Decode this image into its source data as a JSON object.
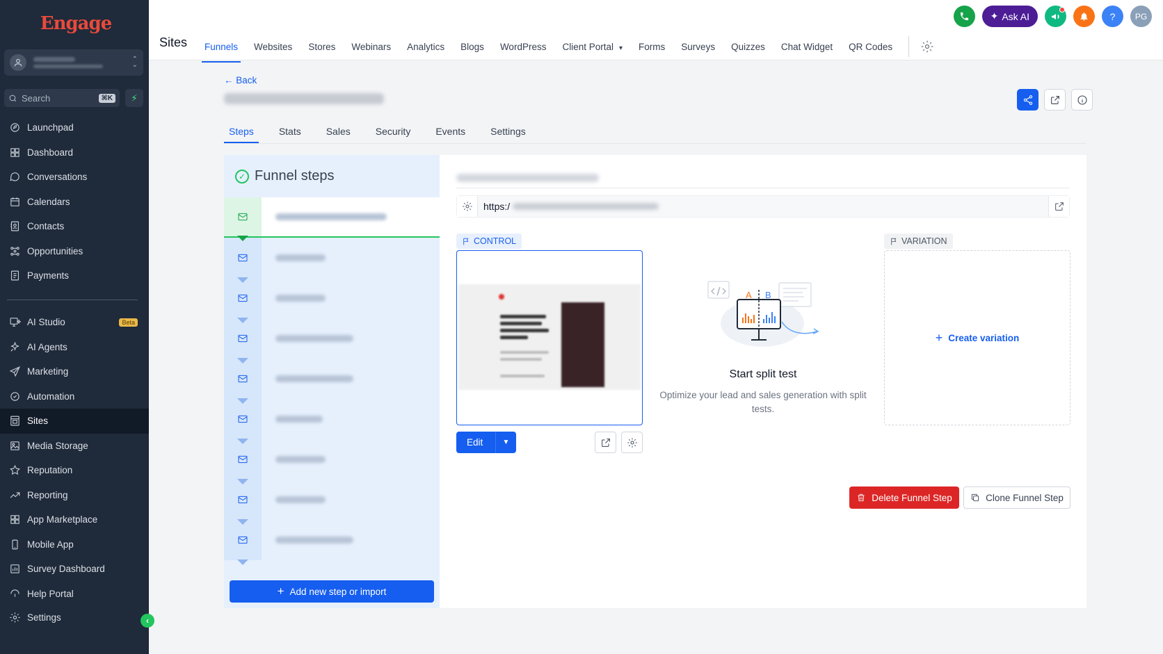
{
  "sidebar": {
    "logo": "Engage",
    "search_label": "Search",
    "search_shortcut": "⌘K",
    "items_top": [
      {
        "label": "Launchpad",
        "icon": "launchpad-icon"
      },
      {
        "label": "Dashboard",
        "icon": "dashboard-icon"
      },
      {
        "label": "Conversations",
        "icon": "chat-icon"
      },
      {
        "label": "Calendars",
        "icon": "calendar-icon"
      },
      {
        "label": "Contacts",
        "icon": "contacts-icon"
      },
      {
        "label": "Opportunities",
        "icon": "opportunities-icon"
      },
      {
        "label": "Payments",
        "icon": "payments-icon"
      }
    ],
    "items_bottom": [
      {
        "label": "AI Studio",
        "icon": "ai-studio-icon",
        "badge": "Beta"
      },
      {
        "label": "AI Agents",
        "icon": "ai-agents-icon"
      },
      {
        "label": "Marketing",
        "icon": "send-icon"
      },
      {
        "label": "Automation",
        "icon": "automation-icon"
      },
      {
        "label": "Sites",
        "icon": "sites-icon",
        "active": true
      },
      {
        "label": "Media Storage",
        "icon": "image-icon"
      },
      {
        "label": "Reputation",
        "icon": "star-icon"
      },
      {
        "label": "Reporting",
        "icon": "trend-icon"
      },
      {
        "label": "App Marketplace",
        "icon": "apps-icon"
      },
      {
        "label": "Mobile App",
        "icon": "mobile-icon"
      },
      {
        "label": "Survey Dashboard",
        "icon": "bar-chart-icon"
      },
      {
        "label": "Help Portal",
        "icon": "help-portal-icon"
      }
    ],
    "settings_label": "Settings"
  },
  "topbar": {
    "section_title": "Sites",
    "nav": [
      "Funnels",
      "Websites",
      "Stores",
      "Webinars",
      "Analytics",
      "Blogs",
      "WordPress",
      "Client Portal",
      "Forms",
      "Surveys",
      "Quizzes",
      "Chat Widget",
      "QR Codes"
    ],
    "active_nav": "Funnels",
    "ask_ai_label": "Ask AI",
    "avatar_initials": "PG",
    "colors": {
      "phone": "#16a34a",
      "askai": "#4c1d95",
      "megaphone": "#10b981",
      "bell": "#f97316",
      "help": "#3b82f6",
      "avatar": "#8aa0b8"
    }
  },
  "page": {
    "back_label": "Back",
    "tabs": [
      "Steps",
      "Stats",
      "Sales",
      "Security",
      "Events",
      "Settings"
    ],
    "active_tab": "Steps"
  },
  "steps_panel": {
    "title": "Funnel steps",
    "add_button_label": "Add new step or import"
  },
  "detail": {
    "url_prefix": "https:/",
    "control_label": "CONTROL",
    "variation_label": "VARIATION",
    "edit_label": "Edit",
    "split_title": "Start split test",
    "split_desc": "Optimize your lead and sales generation with split tests.",
    "create_variation_label": "Create variation",
    "delete_label": "Delete Funnel Step",
    "clone_label": "Clone Funnel Step",
    "illustration_letters": [
      "A",
      "B"
    ]
  },
  "accent": "#155eef"
}
